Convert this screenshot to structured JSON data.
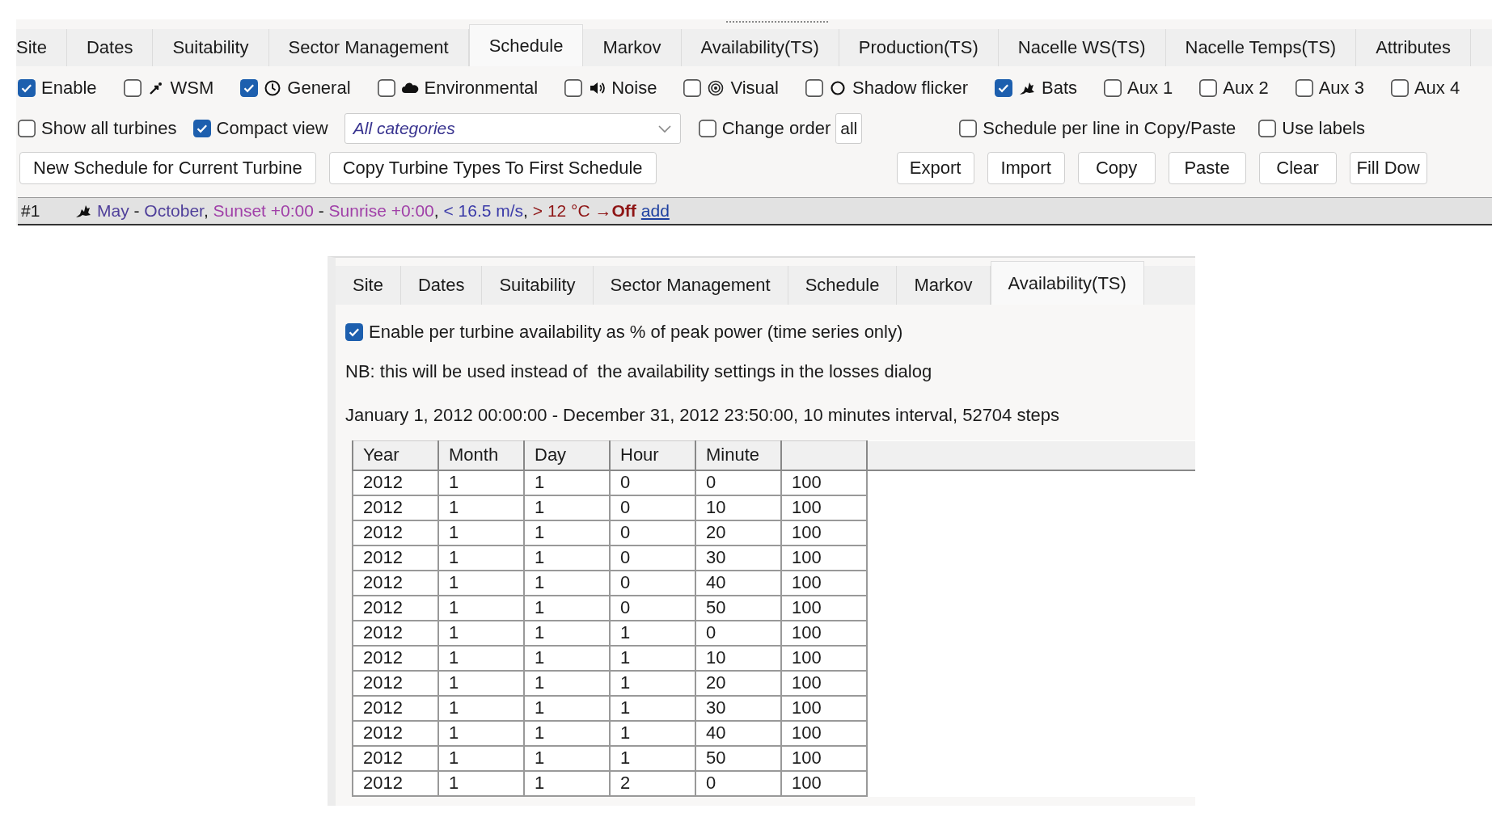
{
  "top_panel": {
    "tabs": [
      {
        "label": "Site",
        "selected": false
      },
      {
        "label": "Dates",
        "selected": false
      },
      {
        "label": "Suitability",
        "selected": false
      },
      {
        "label": "Sector Management",
        "selected": false
      },
      {
        "label": "Schedule",
        "selected": true
      },
      {
        "label": "Markov",
        "selected": false
      },
      {
        "label": "Availability(TS)",
        "selected": false
      },
      {
        "label": "Production(TS)",
        "selected": false
      },
      {
        "label": "Nacelle WS(TS)",
        "selected": false
      },
      {
        "label": "Nacelle Temps(TS)",
        "selected": false
      },
      {
        "label": "Attributes",
        "selected": false
      }
    ],
    "categories": [
      {
        "label": "Enable",
        "checked": true
      },
      {
        "label": "WSM",
        "checked": false
      },
      {
        "label": "General",
        "checked": true
      },
      {
        "label": "Environmental",
        "checked": false
      },
      {
        "label": "Noise",
        "checked": false
      },
      {
        "label": "Visual",
        "checked": false
      },
      {
        "label": "Shadow flicker",
        "checked": false
      },
      {
        "label": "Bats",
        "checked": true
      },
      {
        "label": "Aux 1",
        "checked": false
      },
      {
        "label": "Aux 2",
        "checked": false
      },
      {
        "label": "Aux 3",
        "checked": false
      },
      {
        "label": "Aux 4",
        "checked": false
      }
    ],
    "options": {
      "show_all_turbines": {
        "label": "Show all turbines",
        "checked": false
      },
      "compact_view": {
        "label": "Compact view",
        "checked": true
      },
      "category_dropdown": {
        "value": "All categories"
      },
      "change_order": {
        "label": "Change order",
        "checked": false
      },
      "order_button": "all",
      "schedule_per_line": {
        "label": "Schedule per line in Copy/Paste",
        "checked": false
      },
      "use_labels": {
        "label": "Use labels",
        "checked": false
      }
    },
    "left_buttons": [
      "New Schedule for Current Turbine",
      "Copy Turbine Types To First Schedule"
    ],
    "right_buttons": [
      "Export",
      "Import",
      "Copy",
      "Paste",
      "Clear",
      "Fill Dow"
    ],
    "schedule_line": {
      "number": "#1",
      "segments": [
        {
          "text": "May",
          "color": "#4f3f9a"
        },
        {
          "text": " - "
        },
        {
          "text": "October",
          "color": "#4f3f9a"
        },
        {
          "text": ", "
        },
        {
          "text": "Sunset +0:00",
          "color": "#a040a8"
        },
        {
          "text": " - "
        },
        {
          "text": "Sunrise +0:00",
          "color": "#a040a8"
        },
        {
          "text": ", "
        },
        {
          "text": "< 16.5 m/s",
          "color": "#3a3aa8"
        },
        {
          "text": ", "
        },
        {
          "text": "> 12 °C →**Off**",
          "color": "#8e1515"
        }
      ],
      "link": "add"
    }
  },
  "bottom_panel": {
    "tabs": [
      {
        "label": "Site",
        "selected": false
      },
      {
        "label": "Dates",
        "selected": false
      },
      {
        "label": "Suitability",
        "selected": false
      },
      {
        "label": "Sector Management",
        "selected": false
      },
      {
        "label": "Schedule",
        "selected": false
      },
      {
        "label": "Markov",
        "selected": false
      },
      {
        "label": "Availability(TS)",
        "selected": true
      }
    ],
    "enable": {
      "label": "Enable per turbine availability as % of peak power  (time series only)",
      "checked": true
    },
    "note": "NB: this will be used instead of  the availability settings in the losses dialog",
    "range": "January 1, 2012 00:00:00 - December 31, 2012 23:50:00, 10 minutes interval, 52704 steps",
    "table": {
      "columns": [
        "Year",
        "Month",
        "Day",
        "Hour",
        "Minute"
      ],
      "rows": [
        [
          "2012",
          "1",
          "1",
          "0",
          "0",
          "100"
        ],
        [
          "2012",
          "1",
          "1",
          "0",
          "10",
          "100"
        ],
        [
          "2012",
          "1",
          "1",
          "0",
          "20",
          "100"
        ],
        [
          "2012",
          "1",
          "1",
          "0",
          "30",
          "100"
        ],
        [
          "2012",
          "1",
          "1",
          "0",
          "40",
          "100"
        ],
        [
          "2012",
          "1",
          "1",
          "0",
          "50",
          "100"
        ],
        [
          "2012",
          "1",
          "1",
          "1",
          "0",
          "100"
        ],
        [
          "2012",
          "1",
          "1",
          "1",
          "10",
          "100"
        ],
        [
          "2012",
          "1",
          "1",
          "1",
          "20",
          "100"
        ],
        [
          "2012",
          "1",
          "1",
          "1",
          "30",
          "100"
        ],
        [
          "2012",
          "1",
          "1",
          "1",
          "40",
          "100"
        ],
        [
          "2012",
          "1",
          "1",
          "1",
          "50",
          "100"
        ],
        [
          "2012",
          "1",
          "1",
          "2",
          "0",
          "100"
        ]
      ]
    }
  }
}
